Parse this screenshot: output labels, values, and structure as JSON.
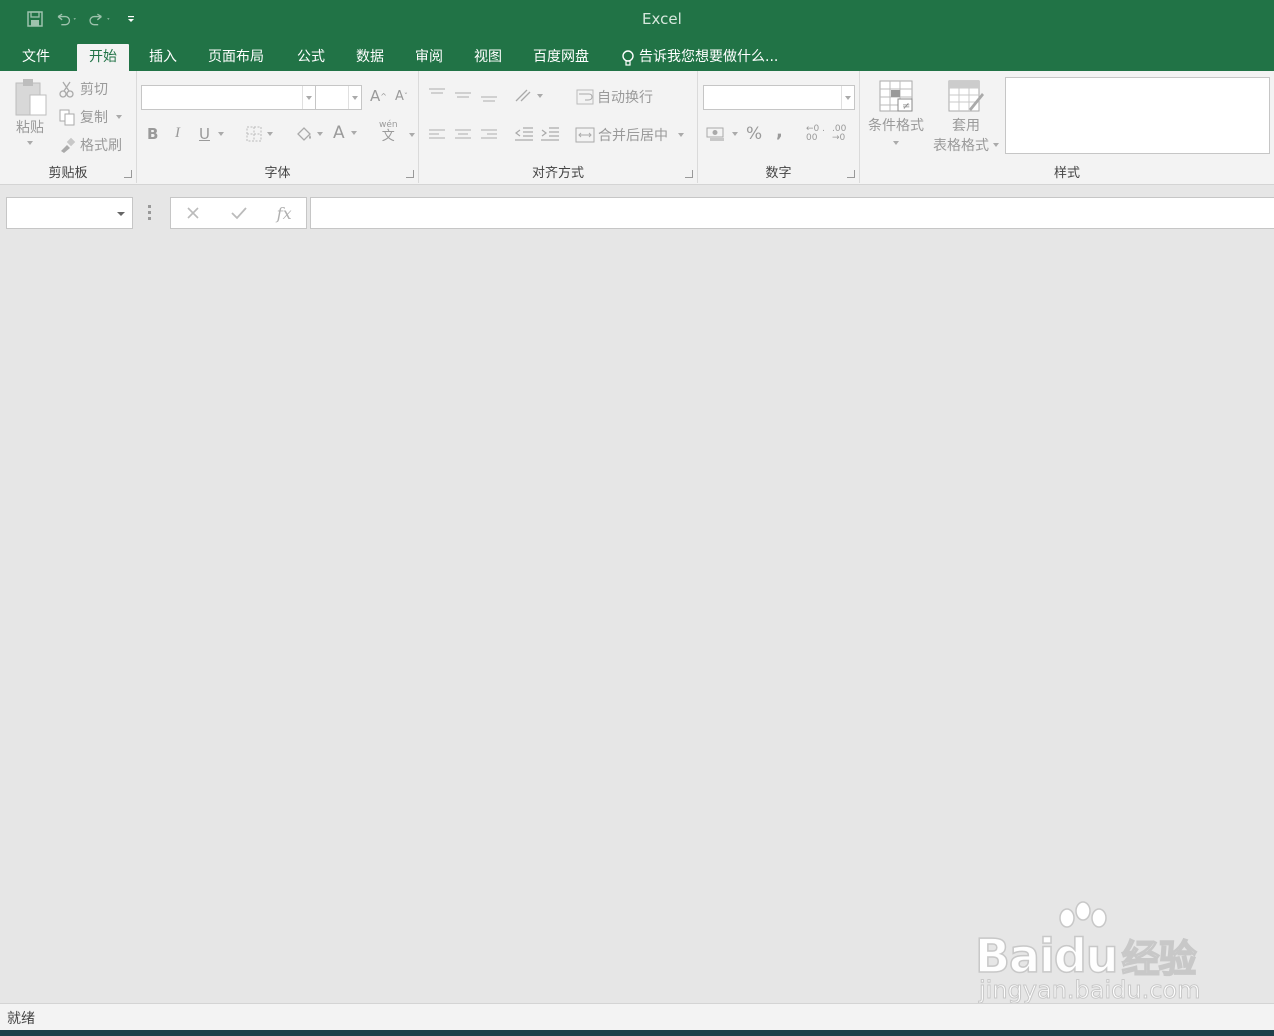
{
  "app": {
    "title": "Excel"
  },
  "tabs": [
    {
      "label": "文件"
    },
    {
      "label": "开始",
      "active": true
    },
    {
      "label": "插入"
    },
    {
      "label": "页面布局"
    },
    {
      "label": "公式"
    },
    {
      "label": "数据"
    },
    {
      "label": "审阅"
    },
    {
      "label": "视图"
    },
    {
      "label": "百度网盘"
    }
  ],
  "tell_me": "告诉我您想要做什么...",
  "clipboard": {
    "paste": "粘贴",
    "cut": "剪切",
    "copy": "复制",
    "format_painter": "格式刷",
    "group_label": "剪贴板"
  },
  "font": {
    "bold": "B",
    "italic": "I",
    "underline": "U",
    "grow": "A",
    "shrink": "A",
    "font_color": "A",
    "phonetic": "wén",
    "phonetic_char": "文",
    "group_label": "字体"
  },
  "alignment": {
    "wrap_text": "自动换行",
    "merge_center": "合并后居中",
    "group_label": "对齐方式"
  },
  "number": {
    "percent": "%",
    "comma": ",",
    "inc_decimal": "←0 .00",
    "dec_decimal": ".00 →0",
    "group_label": "数字"
  },
  "styles": {
    "conditional_format": "条件格式",
    "table_format_line1": "套用",
    "table_format_line2": "表格格式",
    "group_label": "样式"
  },
  "formula_bar": {
    "fx": "fx"
  },
  "status": {
    "text": "就绪"
  },
  "watermark": {
    "brand_a": "Bai",
    "brand_b": "du",
    "brand_c": "经验",
    "url": "jingyan.baidu.com"
  },
  "colors": {
    "excel_green": "#217346",
    "ribbon_bg": "#f3f3f3",
    "canvas_bg": "#e6e6e6"
  }
}
